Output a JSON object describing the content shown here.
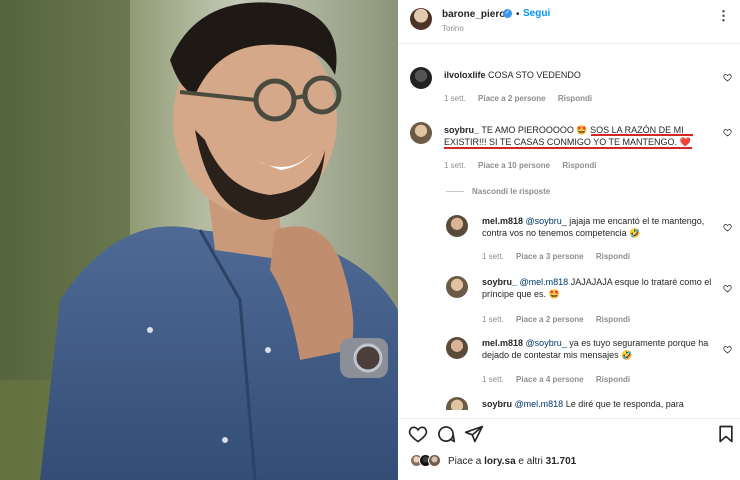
{
  "post": {
    "username": "barone_piero",
    "follow_label": "Segui",
    "location": "Torino",
    "separator": "•",
    "more_label": "⋮"
  },
  "comments": [
    {
      "username": "ilvoloxlife",
      "text": "COSA STO VEDENDO",
      "time": "1 sett.",
      "likes": "Piace a 2 persone",
      "reply": "Rispondi"
    },
    {
      "username": "soybru_",
      "text": "TE AMO PIEROOOOO 🤩 SOS LA RAZÓN DE MI EXISTIR!!! SI TE CASAS CONMIGO YO TE MANTENGO. ❤️",
      "time": "1 sett.",
      "likes": "Piace a 10 persone",
      "reply": "Rispondi"
    }
  ],
  "hide_replies": "Nascondi le risposte",
  "replies": [
    {
      "username": "mel.m818",
      "mention": "@soybru_",
      "text": "jajaja me encantó el te mantengo, contra vos no tenemos competencia 🤣",
      "time": "1 sett.",
      "likes": "Piace a 3 persone",
      "reply": "Rispondi"
    },
    {
      "username": "soybru_",
      "mention": "@mel.m818",
      "text": "JAJAJAJA esque lo trataré como el príncipe que es. 🤩",
      "time": "1 sett.",
      "likes": "Piace a 2 persone",
      "reply": "Rispondi"
    },
    {
      "username": "mel.m818",
      "mention": "@soybru_",
      "text": "ya es tuyo seguramente porque ha dejado de contestar mis mensajes 🤣",
      "time": "1 sett.",
      "likes": "Piace a 4 persone",
      "reply": "Rispondi"
    },
    {
      "username": "soybru",
      "mention": "@mel.m818",
      "text": "Le diré que te responda, para"
    }
  ],
  "likes_bar": {
    "prefix": "Piace a ",
    "user": "lory.sa",
    "suffix": " e altri ",
    "count": "31.701"
  },
  "colors": {
    "link": "#0095f6",
    "verified": "#3897f0",
    "underline": "#d32626"
  },
  "icons": [
    "heart-icon",
    "comment-icon",
    "share-icon",
    "bookmark-icon",
    "more-icon",
    "verified-icon"
  ]
}
